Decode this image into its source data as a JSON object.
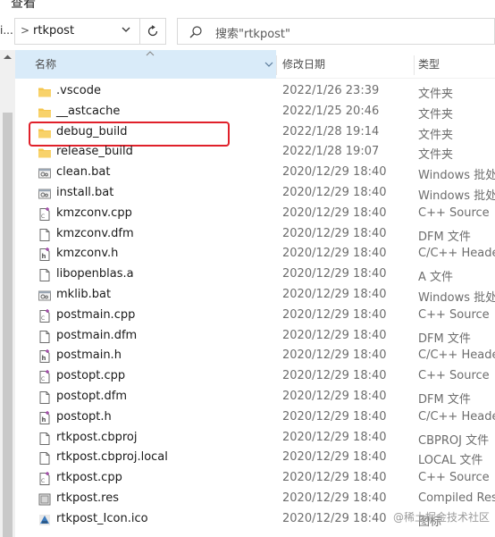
{
  "menu": {
    "label": "查看"
  },
  "address": {
    "separator": ">",
    "path": "rtkpost",
    "cut_left": "i..."
  },
  "search": {
    "placeholder": "搜索\"rtkpost\""
  },
  "columns": {
    "name": "名称",
    "date": "修改日期",
    "type": "类型"
  },
  "files": [
    {
      "name": ".vscode",
      "date": "2022/1/26 23:39",
      "type": "文件夹",
      "icon": "folder-icon"
    },
    {
      "name": "__astcache",
      "date": "2022/1/25 20:46",
      "type": "文件夹",
      "icon": "folder-icon"
    },
    {
      "name": "debug_build",
      "date": "2022/1/28 19:14",
      "type": "文件夹",
      "icon": "folder-icon",
      "highlighted": true
    },
    {
      "name": "release_build",
      "date": "2022/1/28 19:07",
      "type": "文件夹",
      "icon": "folder-icon"
    },
    {
      "name": "clean.bat",
      "date": "2020/12/29 18:40",
      "type": "Windows 批处",
      "icon": "batch-file-icon"
    },
    {
      "name": "install.bat",
      "date": "2020/12/29 18:40",
      "type": "Windows 批处",
      "icon": "batch-file-icon"
    },
    {
      "name": "kmzconv.cpp",
      "date": "2020/12/29 18:40",
      "type": "C++ Source",
      "icon": "cpp-file-icon"
    },
    {
      "name": "kmzconv.dfm",
      "date": "2020/12/29 18:40",
      "type": "DFM 文件",
      "icon": "generic-file-icon"
    },
    {
      "name": "kmzconv.h",
      "date": "2020/12/29 18:40",
      "type": "C/C++ Heade",
      "icon": "header-file-icon"
    },
    {
      "name": "libopenblas.a",
      "date": "2020/12/29 18:40",
      "type": "A 文件",
      "icon": "generic-file-icon"
    },
    {
      "name": "mklib.bat",
      "date": "2020/12/29 18:40",
      "type": "Windows 批处",
      "icon": "batch-file-icon"
    },
    {
      "name": "postmain.cpp",
      "date": "2020/12/29 18:40",
      "type": "C++ Source",
      "icon": "cpp-file-icon"
    },
    {
      "name": "postmain.dfm",
      "date": "2020/12/29 18:40",
      "type": "DFM 文件",
      "icon": "generic-file-icon"
    },
    {
      "name": "postmain.h",
      "date": "2020/12/29 18:40",
      "type": "C/C++ Heade",
      "icon": "header-file-icon"
    },
    {
      "name": "postopt.cpp",
      "date": "2020/12/29 18:40",
      "type": "C++ Source",
      "icon": "cpp-file-icon"
    },
    {
      "name": "postopt.dfm",
      "date": "2020/12/29 18:40",
      "type": "DFM 文件",
      "icon": "generic-file-icon"
    },
    {
      "name": "postopt.h",
      "date": "2020/12/29 18:40",
      "type": "C/C++ Heade",
      "icon": "header-file-icon"
    },
    {
      "name": "rtkpost.cbproj",
      "date": "2020/12/29 18:40",
      "type": "CBPROJ 文件",
      "icon": "generic-file-icon"
    },
    {
      "name": "rtkpost.cbproj.local",
      "date": "2020/12/29 18:40",
      "type": "LOCAL 文件",
      "icon": "generic-file-icon"
    },
    {
      "name": "rtkpost.cpp",
      "date": "2020/12/29 18:40",
      "type": "C++ Source",
      "icon": "cpp-file-icon"
    },
    {
      "name": "rtkpost.res",
      "date": "2020/12/29 18:40",
      "type": "Compiled Res",
      "icon": "resource-file-icon"
    },
    {
      "name": "rtkpost_Icon.ico",
      "date": "2020/12/29 18:40",
      "type": "图标",
      "icon": "ico-file-icon"
    }
  ],
  "watermark": "@稀土掘金技术社区",
  "colors": {
    "header_active_bg": "#d9ebf9",
    "folder": "#f5c64e",
    "highlight_box": "#e0202a"
  }
}
